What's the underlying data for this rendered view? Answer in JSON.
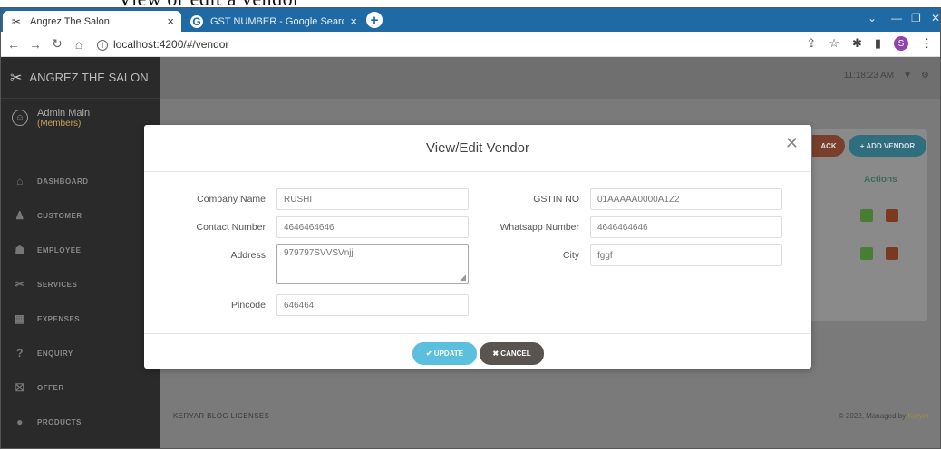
{
  "caption": "View or edit a vendor",
  "browser": {
    "tabs": [
      {
        "title": "Angrez The Salon",
        "active": true
      },
      {
        "title": "GST NUMBER - Google Search",
        "active": false
      }
    ],
    "url": "localhost:4200/#/vendor",
    "profile_initial": "S"
  },
  "app": {
    "brand": "ANGREZ THE SALON",
    "user_name": "Admin Main",
    "user_role": "(Members)",
    "menu": [
      "DASHBOARD",
      "CUSTOMER",
      "EMPLOYEE",
      "SERVICES",
      "EXPENSES",
      "ENQUIRY",
      "OFFER",
      "PRODUCTS"
    ],
    "header_time": "11:18:23 AM",
    "back_label": "ACK",
    "add_vendor_label": "+ ADD VENDOR",
    "actions_header": "Actions",
    "footer_links": "KERYAR   BLOG   LICENSES",
    "footer_copy": "© 2022, Managed by",
    "footer_brand": "Keryar"
  },
  "modal": {
    "title": "View/Edit Vendor",
    "fields": {
      "company_name": {
        "label": "Company Name",
        "value": "RUSHI"
      },
      "gstin_no": {
        "label": "GSTIN NO",
        "value": "01AAAAA0000A1Z2"
      },
      "contact_number": {
        "label": "Contact Number",
        "value": "4646464646"
      },
      "whatsapp_number": {
        "label": "Whatsapp Number",
        "value": "4646464646"
      },
      "address": {
        "label": "Address",
        "value": "979797SVVSVnjj"
      },
      "city": {
        "label": "City",
        "value": "fggf"
      },
      "pincode": {
        "label": "Pincode",
        "value": "646464"
      }
    },
    "update_label": "✔ UPDATE",
    "cancel_label": "✖ CANCEL"
  },
  "colors": {
    "tabbar": "#1f6aa5",
    "update_button": "#5bc0de",
    "cancel_button": "#5a5450",
    "add_vendor_button": "#2f6e7c"
  }
}
